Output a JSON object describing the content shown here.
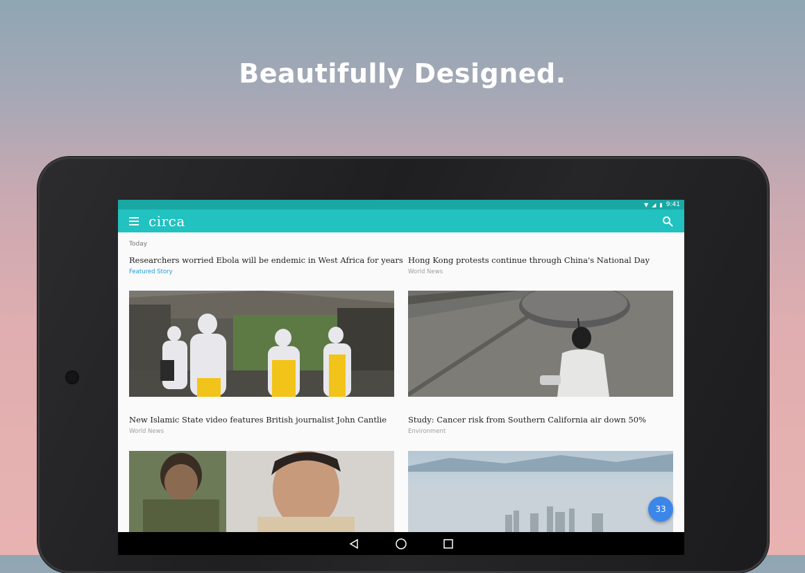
{
  "promo": {
    "headline": "Beautifully Designed."
  },
  "status_bar": {
    "time": "9:41"
  },
  "app_bar": {
    "title": "circa"
  },
  "feed": {
    "section_label": "Today",
    "stories": [
      {
        "title": "Researchers worried Ebola will be endemic in West Africa for years",
        "category": "Featured Story",
        "image": "ebola-workers-image"
      },
      {
        "title": "Hong Kong protests continue through China's National Day",
        "category": "World News",
        "image": "umbrella-protester-image"
      },
      {
        "title": "New Islamic State video features British journalist John Cantlie",
        "category": "World News",
        "image": "john-cantlie-image"
      },
      {
        "title": "Study: Cancer risk from Southern California air down 50%",
        "category": "Environment",
        "image": "smoggy-skyline-image"
      }
    ]
  },
  "fab": {
    "count": "33"
  },
  "colors": {
    "accent": "#21c2c0",
    "status": "#1aa8a4",
    "featured": "#1e9cd7",
    "fab": "#3b86e8"
  },
  "icons": [
    "menu-icon",
    "search-icon",
    "wifi-icon",
    "signal-icon",
    "battery-icon",
    "back-icon",
    "home-icon",
    "recents-icon"
  ]
}
